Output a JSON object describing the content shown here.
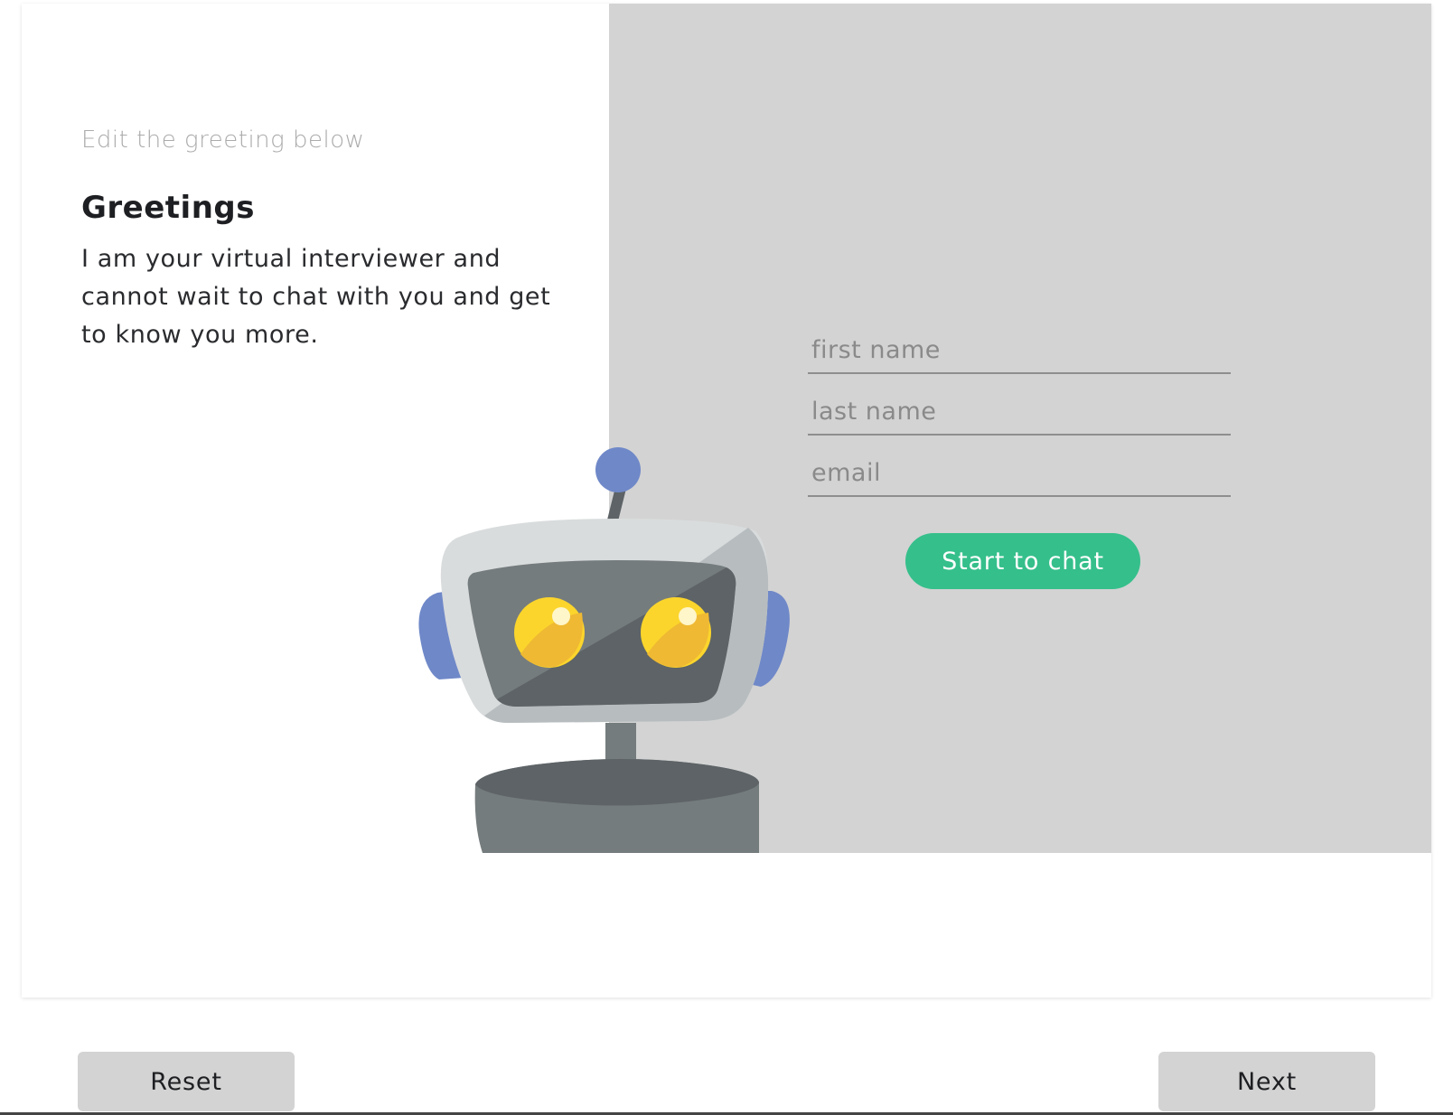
{
  "editor": {
    "hint": "Edit the greeting below",
    "title": "Greetings",
    "body": "I am your virtual interviewer and cannot wait to chat with you and get to know you more."
  },
  "form": {
    "first_name_placeholder": "first name",
    "last_name_placeholder": "last name",
    "email_placeholder": "email",
    "start_button": "Start to chat"
  },
  "footer": {
    "reset_label": "Reset",
    "next_label": "Next"
  },
  "colors": {
    "accent": "#35bf8b",
    "panel": "#d3d3d3",
    "robot_blue": "#6f88c8",
    "robot_eye": "#fbd52c"
  },
  "icons": {
    "robot": "robot-mascot-icon"
  }
}
